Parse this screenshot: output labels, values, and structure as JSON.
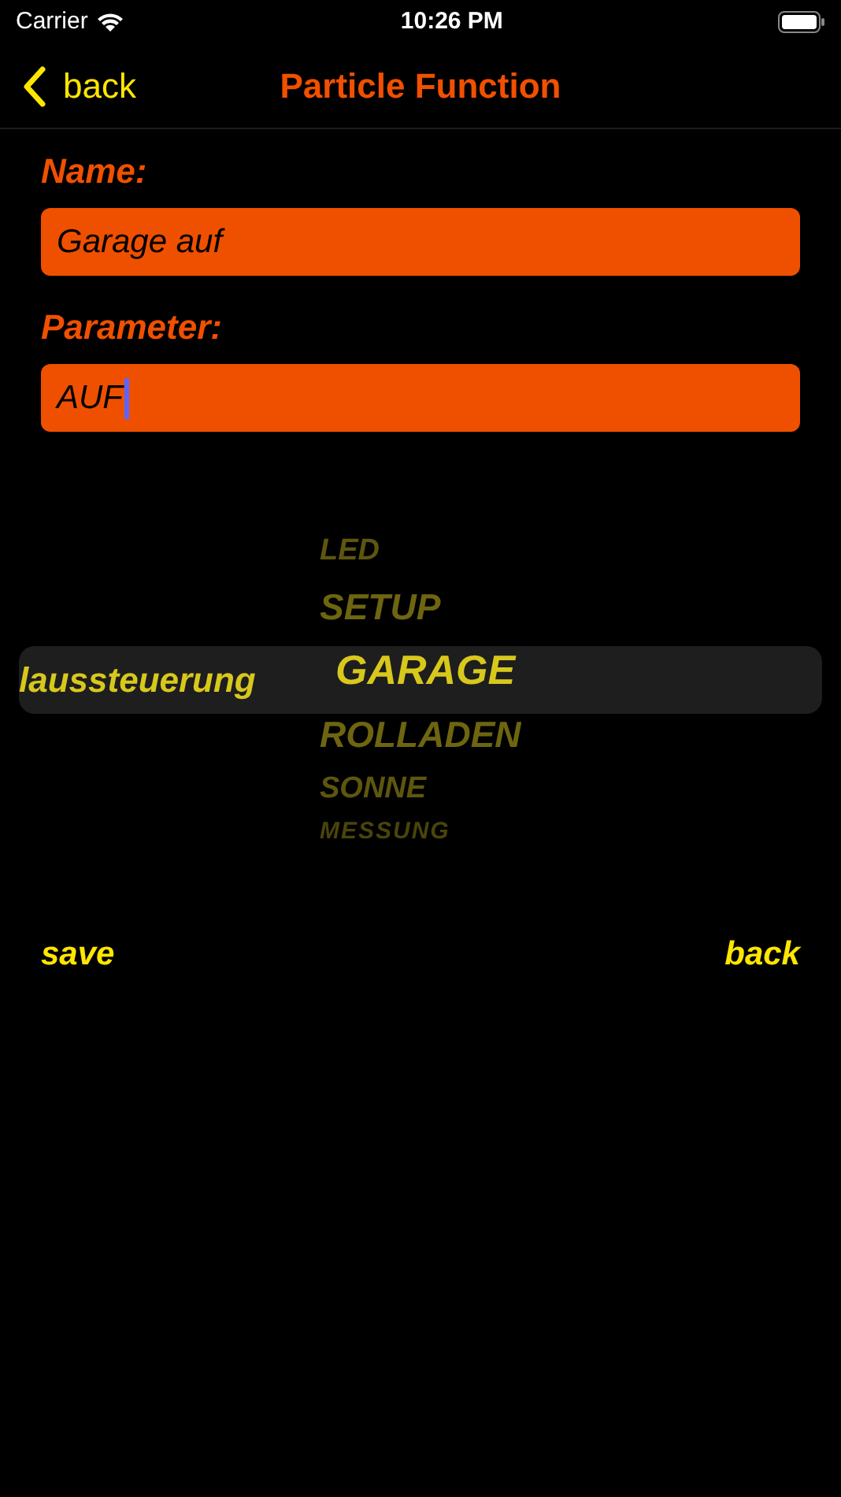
{
  "status_bar": {
    "carrier": "Carrier",
    "time": "10:26 PM"
  },
  "nav": {
    "back": "back",
    "title": "Particle Function"
  },
  "fields": [
    {
      "label": "Name:",
      "value": "Garage auf",
      "focused": false
    },
    {
      "label": "Parameter:",
      "value": "AUF",
      "focused": true
    }
  ],
  "picker": {
    "left_column": [
      {
        "label": "laussteuerung",
        "selected": true
      }
    ],
    "right_column": [
      {
        "label": "LED",
        "selected": false
      },
      {
        "label": "SETUP",
        "selected": false
      },
      {
        "label": "GARAGE",
        "selected": true
      },
      {
        "label": "ROLLADEN",
        "selected": false
      },
      {
        "label": "SONNE",
        "selected": false
      },
      {
        "label": "MESSUNG",
        "selected": false
      }
    ]
  },
  "buttons": [
    {
      "label": "save"
    },
    {
      "label": "back"
    }
  ]
}
